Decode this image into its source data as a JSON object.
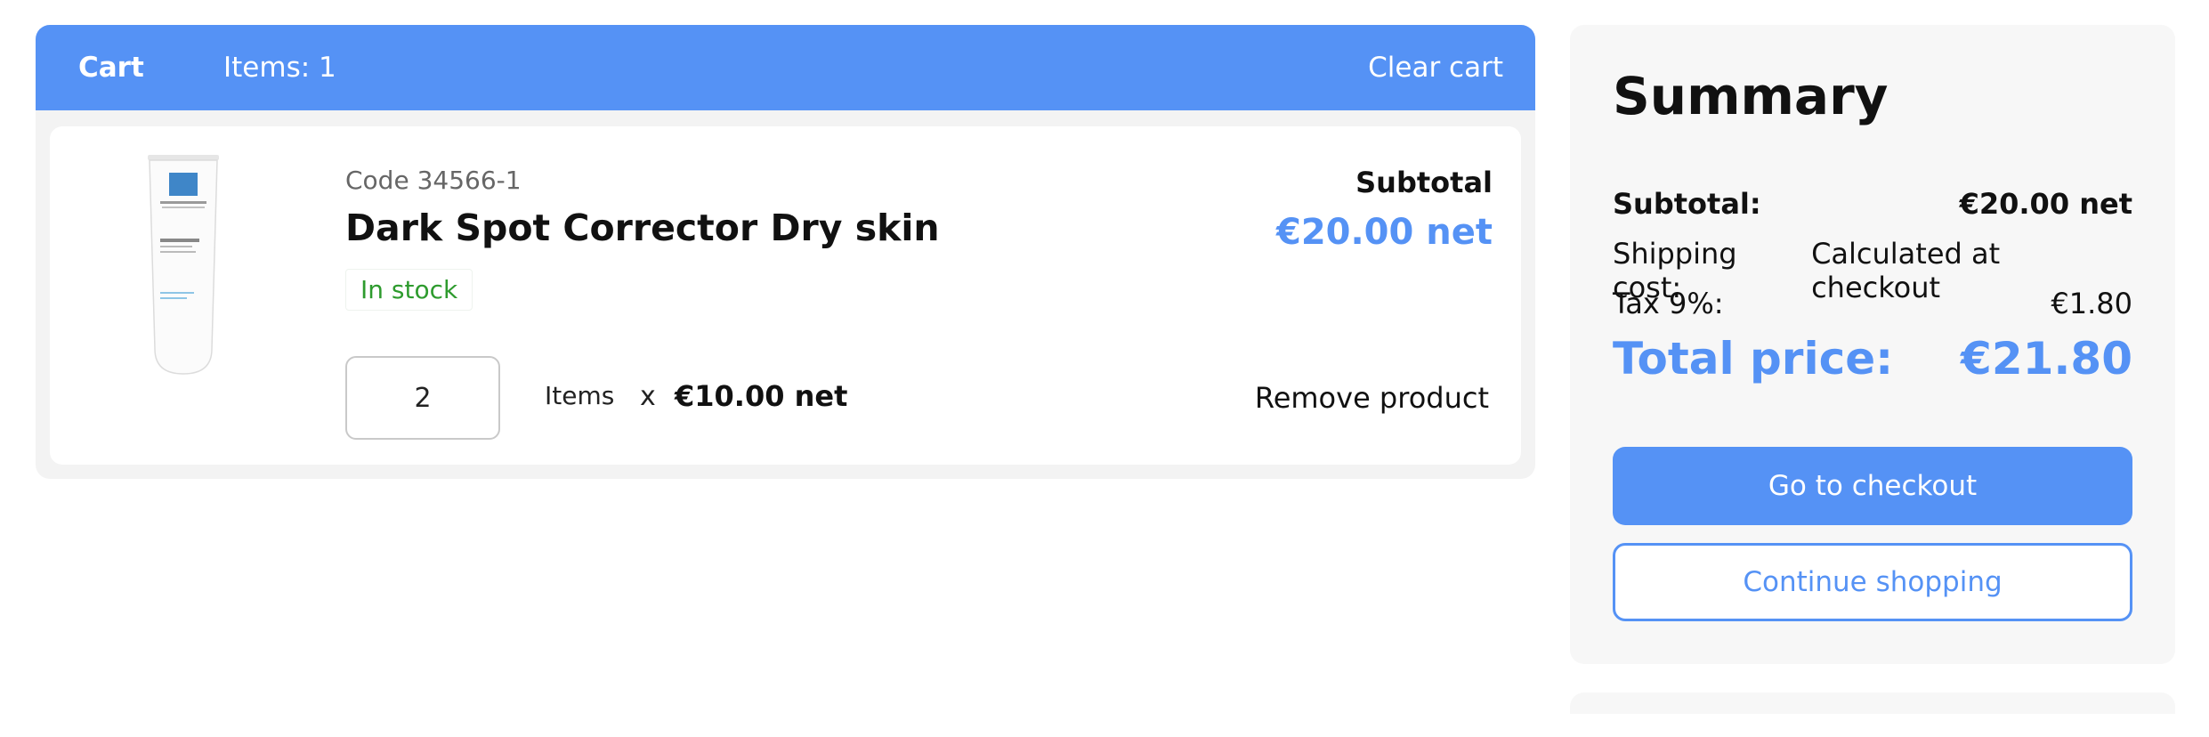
{
  "cart": {
    "title": "Cart",
    "items_count": "Items: 1",
    "clear_label": "Clear cart"
  },
  "item": {
    "code": "Code 34566-1",
    "name": "Dark Spot Corrector Dry skin",
    "stock": "In stock",
    "quantity": "2",
    "quantity_label": "Items",
    "times": "x",
    "unit_price": "€10.00 net",
    "subtotal_label": "Subtotal",
    "subtotal_value": "€20.00 net",
    "remove_label": "Remove product",
    "image_icon": "product-tube-icon",
    "image_brand_text": "LA ROCHE-POSAY",
    "image_product_text": "EFFACLAR"
  },
  "summary": {
    "title": "Summary",
    "subtotal_label": "Subtotal:",
    "subtotal_value": "€20.00 net",
    "shipping_label": "Shipping cost:",
    "shipping_value": "Calculated at checkout",
    "tax_label": "Tax 9%:",
    "tax_value": "€1.80",
    "total_label": "Total price:",
    "total_value": "€21.80",
    "checkout_label": "Go to checkout",
    "continue_label": "Continue shopping"
  },
  "colors": {
    "accent": "#5592f5",
    "stock_green": "#2e9b2e",
    "panel_bg": "#f3f3f3"
  }
}
